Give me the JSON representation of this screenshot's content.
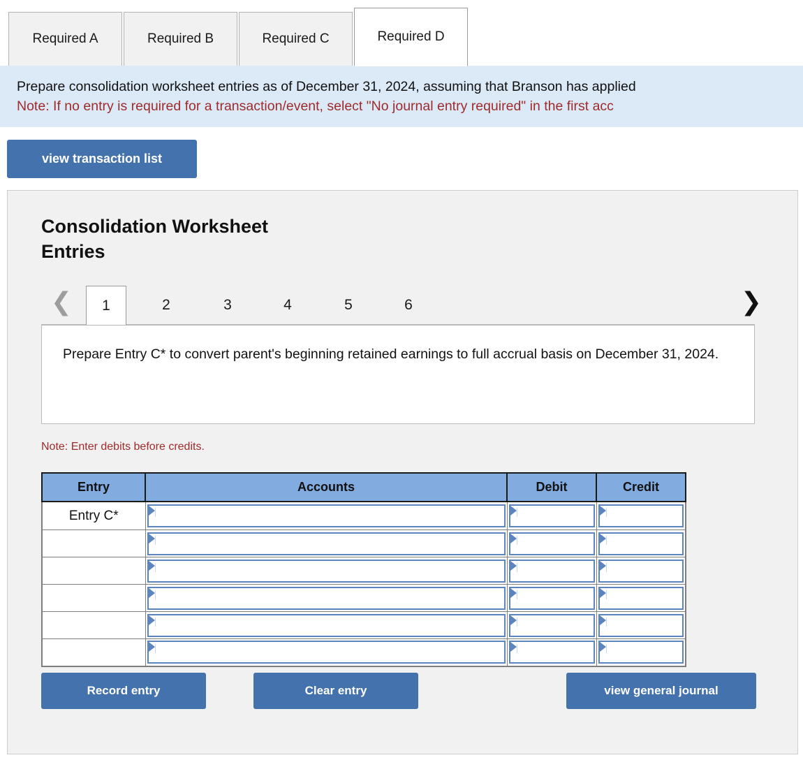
{
  "requirement_tabs": [
    {
      "label": "Required A",
      "active": false
    },
    {
      "label": "Required B",
      "active": false
    },
    {
      "label": "Required C",
      "active": false
    },
    {
      "label": "Required D",
      "active": true
    }
  ],
  "banner": {
    "instruction": "Prepare consolidation worksheet entries as of December 31, 2024, assuming that Branson has applied",
    "note": "Note: If no entry is required for a transaction/event, select \"No journal entry required\" in the first acc",
    "background_color": "#dceaf7",
    "note_color": "#9e2b2b"
  },
  "toolbar": {
    "view_transaction_list_label": "view transaction list"
  },
  "panel": {
    "title": "Consolidation Worksheet Entries",
    "title_line1": "Consolidation Worksheet",
    "title_line2": "Entries",
    "background_color": "#f1f1f1"
  },
  "pager": {
    "prev_icon": "chevron-left-icon",
    "next_icon": "chevron-right-icon",
    "prev_enabled": false,
    "next_enabled": true,
    "pages": [
      {
        "label": "1",
        "active": true
      },
      {
        "label": "2",
        "active": false
      },
      {
        "label": "3",
        "active": false
      },
      {
        "label": "4",
        "active": false
      },
      {
        "label": "5",
        "active": false
      },
      {
        "label": "6",
        "active": false
      }
    ]
  },
  "prompt": {
    "text": "Prepare Entry C* to convert parent's beginning retained earnings to full accrual basis on December 31, 2024."
  },
  "note": {
    "debits_before_credits": "Note: Enter debits before credits."
  },
  "journal_table": {
    "header_color": "#82abe0",
    "columns": [
      "Entry",
      "Accounts",
      "Debit",
      "Credit"
    ],
    "rows": [
      {
        "entry": "Entry C*",
        "accounts": "",
        "debit": "",
        "credit": ""
      },
      {
        "entry": "",
        "accounts": "",
        "debit": "",
        "credit": ""
      },
      {
        "entry": "",
        "accounts": "",
        "debit": "",
        "credit": ""
      },
      {
        "entry": "",
        "accounts": "",
        "debit": "",
        "credit": ""
      },
      {
        "entry": "",
        "accounts": "",
        "debit": "",
        "credit": ""
      },
      {
        "entry": "",
        "accounts": "",
        "debit": "",
        "credit": ""
      }
    ]
  },
  "actions": {
    "record_entry_label": "Record entry",
    "clear_entry_label": "Clear entry",
    "view_general_journal_label": "view general journal",
    "button_color": "#4472ac"
  }
}
